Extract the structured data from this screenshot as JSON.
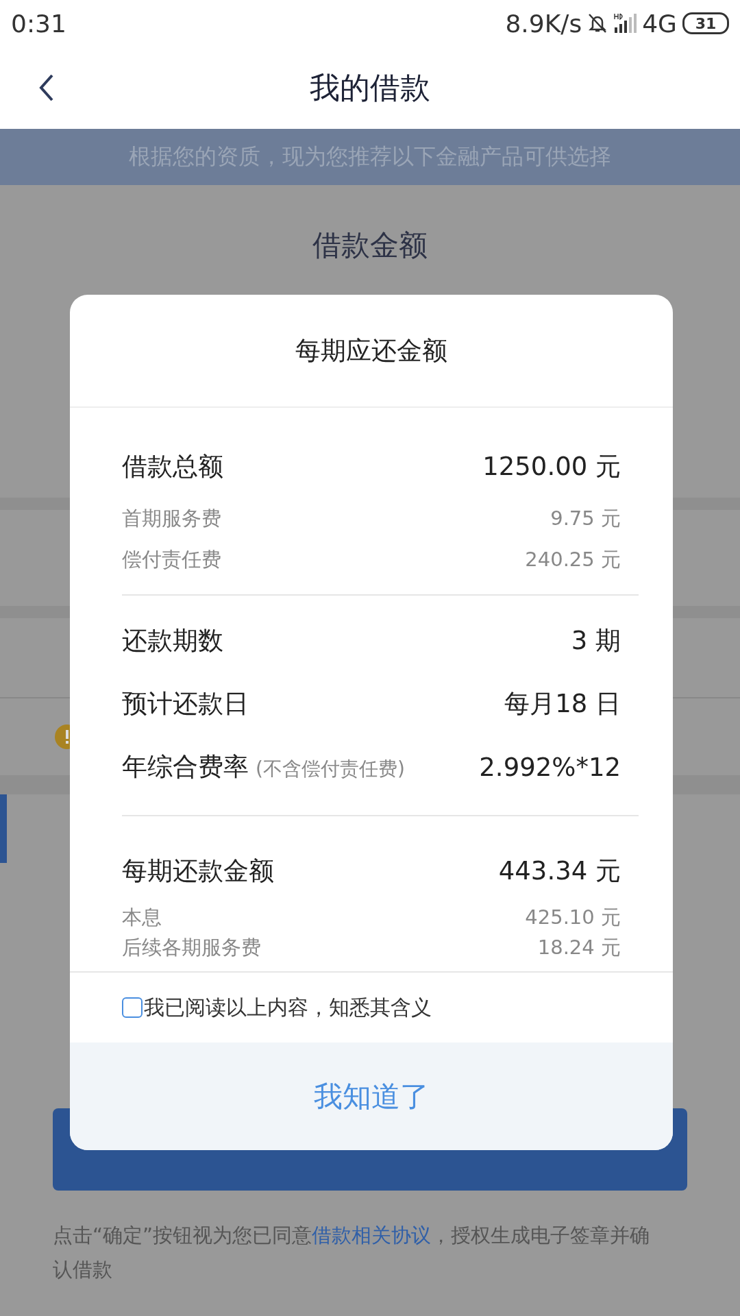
{
  "status_bar": {
    "time": "0:31",
    "net_speed": "8.9K/s",
    "network": "4G",
    "battery": "31",
    "muted": true
  },
  "header": {
    "title": "我的借款"
  },
  "banner": {
    "text": "根据您的资质，现为您推荐以下金融产品可供选择"
  },
  "background": {
    "title": "借款金额",
    "footer": {
      "before": "点击“确定”按钮视为您已同意",
      "link": "借款相关协议",
      "after": "，授权生成电子签章并确认借款"
    }
  },
  "dialog": {
    "title": "每期应还金额",
    "sections": [
      {
        "rows": [
          {
            "kind": "main",
            "label": "借款总额",
            "value": "1250.00 元"
          },
          {
            "kind": "sub",
            "label": "首期服务费",
            "value": "9.75 元"
          },
          {
            "kind": "sub",
            "label": "偿付责任费",
            "value": "240.25 元"
          }
        ]
      },
      {
        "rows": [
          {
            "kind": "main",
            "label": "还款期数",
            "value": "3 期"
          },
          {
            "kind": "main",
            "label": "预计还款日",
            "value": "每月18 日"
          },
          {
            "kind": "main",
            "label": "年综合费率",
            "note": "(不含偿付责任费)",
            "value": "2.992%*12"
          }
        ]
      },
      {
        "rows": [
          {
            "kind": "main",
            "label": "每期还款金额",
            "value": "443.34 元"
          },
          {
            "kind": "compact",
            "label": "本息",
            "value": "425.10 元"
          },
          {
            "kind": "compact",
            "label": "后续各期服务费",
            "value": "18.24 元"
          }
        ]
      }
    ],
    "agreement": {
      "label": "我已阅读以上内容，知悉其含义",
      "checked": false
    },
    "button": "我知道了"
  }
}
